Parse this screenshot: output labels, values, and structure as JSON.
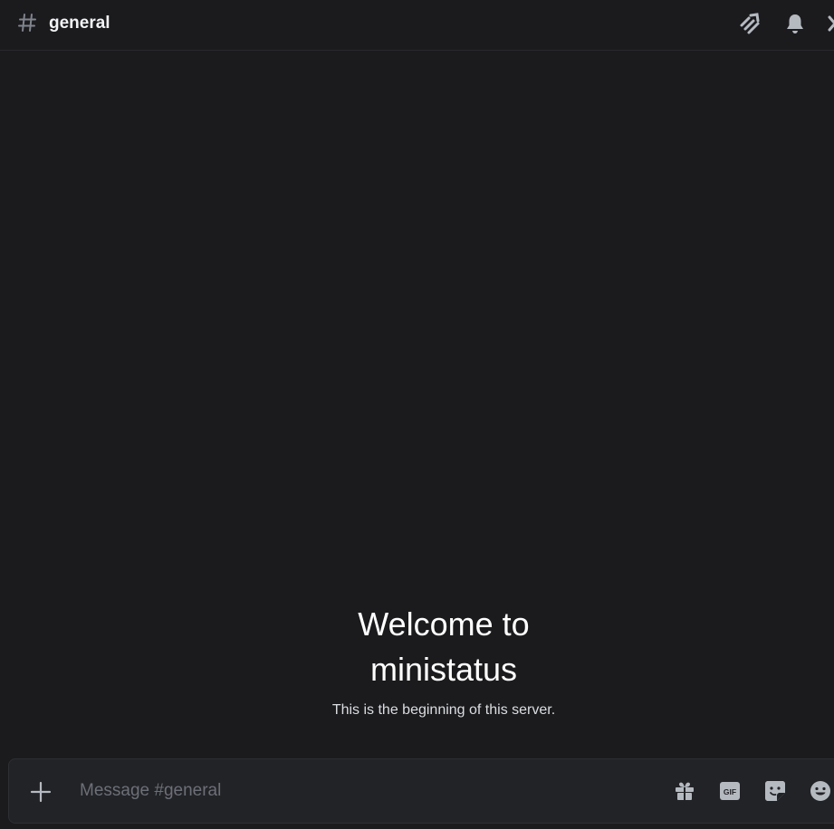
{
  "header": {
    "channel_name": "general",
    "icons": [
      "hash-icon",
      "threads-icon",
      "bell-icon",
      "members-icon"
    ]
  },
  "welcome": {
    "title_line1": "Welcome to",
    "title_line2": "ministatus",
    "subtitle": "This is the beginning of this server."
  },
  "composer": {
    "placeholder": "Message #general",
    "value": "",
    "icons": [
      "plus-icon",
      "gift-icon",
      "gif-icon",
      "sticker-icon",
      "emoji-icon"
    ],
    "gif_label": "GIF"
  },
  "colors": {
    "background": "#1b1b1e",
    "composer_bg": "#222327",
    "icon": "#b5bac1",
    "text": "#f2f3f5",
    "muted": "#6d6f78"
  }
}
